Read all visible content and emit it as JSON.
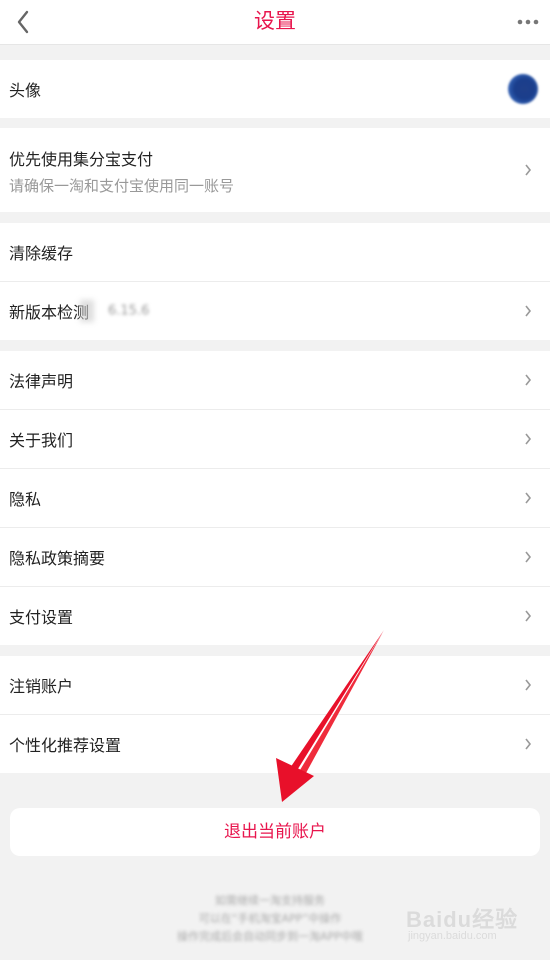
{
  "nav": {
    "title": "设置",
    "back_icon": "chevron-left-icon",
    "more_icon": "more-dots-icon"
  },
  "groups": [
    {
      "rows": [
        {
          "label": "头像",
          "right": "avatar"
        }
      ]
    },
    {
      "rows": [
        {
          "label": "优先使用集分宝支付",
          "sub": "请确保一淘和支付宝使用同一账号",
          "right": "chevron-right-icon"
        }
      ]
    },
    {
      "rows": [
        {
          "label": "清除缓存"
        },
        {
          "label": "新版本检测",
          "version": "6.15.6",
          "right": "chevron-right-icon"
        }
      ]
    },
    {
      "rows": [
        {
          "label": "法律声明",
          "right": "chevron-right-icon"
        },
        {
          "label": "关于我们",
          "right": "chevron-right-icon"
        },
        {
          "label": "隐私",
          "right": "chevron-right-icon"
        },
        {
          "label": "隐私政策摘要",
          "right": "chevron-right-icon"
        },
        {
          "label": "支付设置",
          "right": "chevron-right-icon"
        }
      ]
    },
    {
      "rows": [
        {
          "label": "注销账户",
          "right": "chevron-right-icon"
        },
        {
          "label": "个性化推荐设置",
          "right": "chevron-right-icon"
        }
      ]
    }
  ],
  "logout": {
    "label": "退出当前账户"
  },
  "footer": {
    "lines": [
      "如需继续一淘支持服务",
      "可以在“手机淘宝APP”中操作",
      "操作完成后会自动同步到一淘APP中哦"
    ]
  },
  "watermark": {
    "brand": "Baidu经验",
    "url": "jingyan.baidu.com"
  },
  "colors": {
    "accent": "#e8154d",
    "annotation_arrow": "#e8102a"
  }
}
